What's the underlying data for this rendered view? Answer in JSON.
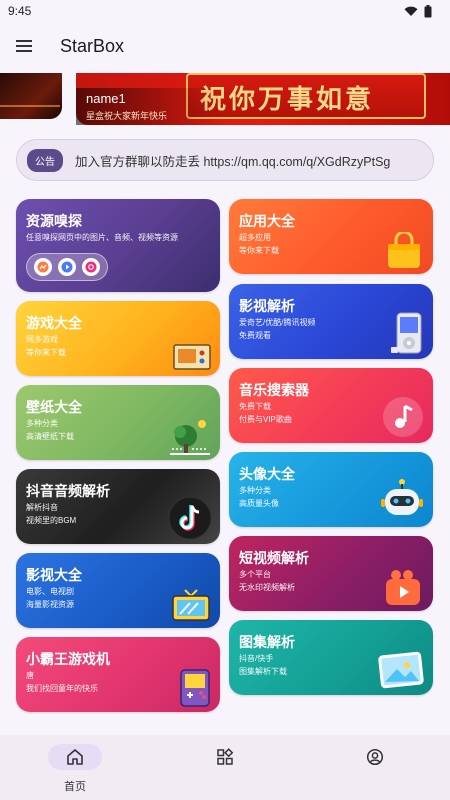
{
  "status_bar": {
    "time": "9:45"
  },
  "app_bar": {
    "title": "StarBox"
  },
  "banner": {
    "name": "name1",
    "subtitle": "星盒祝大家新年快乐",
    "art_text": "祝你万事如意"
  },
  "notice": {
    "badge": "公告",
    "text": "加入官方群聊以防走丢 https://qm.qq.com/q/XGdRzyPtSg"
  },
  "cards_left": [
    {
      "title": "资源嗅探",
      "line1": "任意嗅探网页中的图片、音频、视频等资源",
      "line2": ""
    },
    {
      "title": "游戏大全",
      "line1": "网多游戏",
      "line2": "等你来下载"
    },
    {
      "title": "壁纸大全",
      "line1": "多种分类",
      "line2": "高清壁纸下载"
    },
    {
      "title": "抖音音频解析",
      "line1": "解析抖音",
      "line2": "视频里的BGM"
    },
    {
      "title": "影视大全",
      "line1": "电影、电视剧",
      "line2": "海量影视资源"
    },
    {
      "title": "小霸王游戏机",
      "line1": "唐",
      "line2": "我们找回童年的快乐"
    }
  ],
  "cards_right": [
    {
      "title": "应用大全",
      "line1": "超多应用",
      "line2": "等你来下载"
    },
    {
      "title": "影视解析",
      "line1": "爱奇艺/优酷/腾讯视频",
      "line2": "免费观看"
    },
    {
      "title": "音乐搜索器",
      "line1": "免费下载",
      "line2": "付费与VIP歌曲"
    },
    {
      "title": "头像大全",
      "line1": "多种分类",
      "line2": "高质量头像"
    },
    {
      "title": "短视频解析",
      "line1": "多个平台",
      "line2": "无水印视频解析"
    },
    {
      "title": "图集解析",
      "line1": "抖音/快手",
      "line2": "图集解析下载"
    }
  ],
  "colors": {
    "accent": "#5b4b8a",
    "nav_active": "#e6dcf5"
  },
  "bottom_nav": [
    {
      "label": "首页",
      "icon": "home-icon"
    },
    {
      "label": "",
      "icon": "apps-grid-icon"
    },
    {
      "label": "",
      "icon": "profile-icon"
    }
  ]
}
